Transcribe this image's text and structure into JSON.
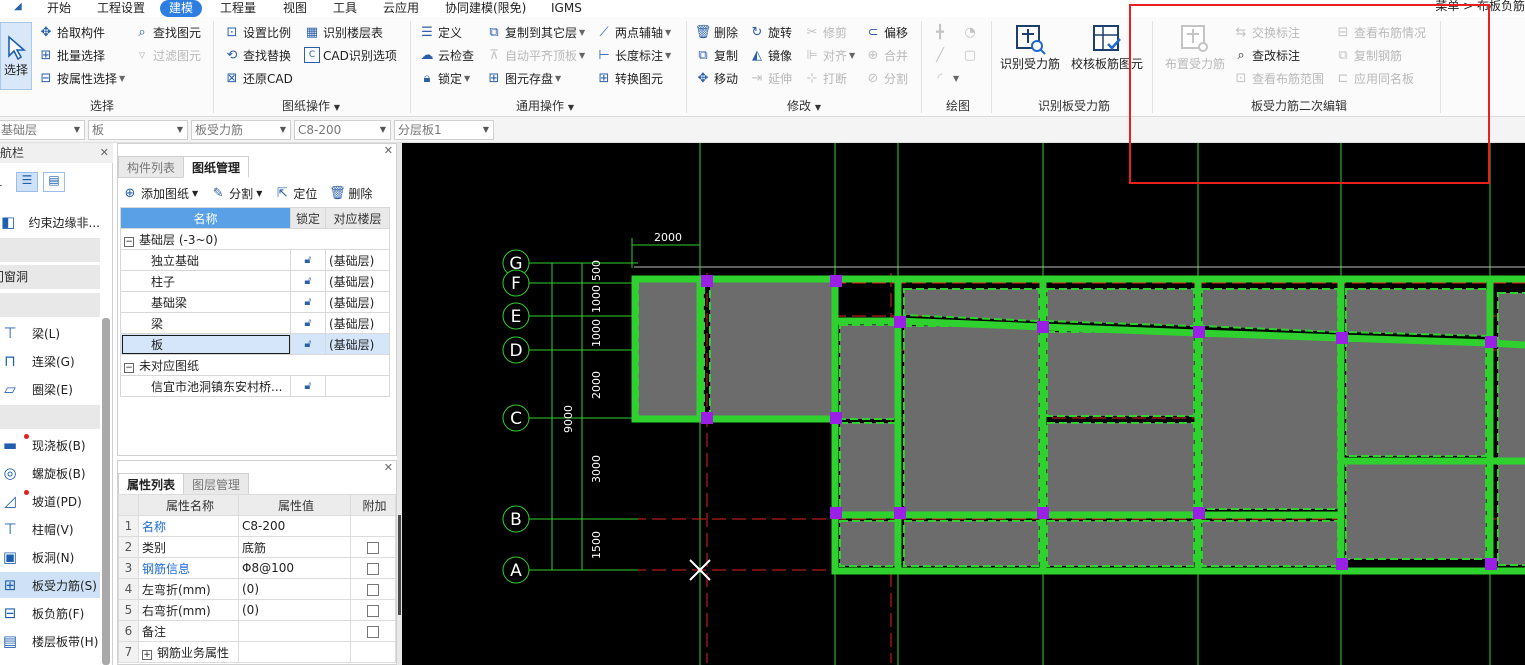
{
  "menu": {
    "items": [
      "开始",
      "工程设置",
      "建模",
      "工程量",
      "视图",
      "工具",
      "云应用",
      "协同建模(限免)",
      "IGMS"
    ],
    "active": "建模",
    "breadcrumb": "菜单 > 布板负筋"
  },
  "ribbon": {
    "select_group": {
      "label": "选择",
      "select_button": "选择",
      "pick_component": "拾取构件",
      "batch_select": "批量选择",
      "select_by_attr": "按属性选择",
      "find_element": "查找图元",
      "filter_element": "过滤图元"
    },
    "drawing_group": {
      "label": "图纸操作",
      "set_scale": "设置比例",
      "find_replace": "查找替换",
      "restore_cad": "还原CAD",
      "identify_floor_table": "识别楼层表",
      "cad_options": "CAD识别选项"
    },
    "general_group": {
      "label": "通用操作",
      "define": "定义",
      "cloud_check": "云检查",
      "lock": "锁定",
      "copy_to_other_floor": "复制到其它层",
      "auto_align_top": "自动平齐顶板",
      "element_save": "图元存盘",
      "two_point_axis": "两点辅轴",
      "length_label": "长度标注",
      "convert_element": "转换图元"
    },
    "modify_group": {
      "label": "修改",
      "delete": "删除",
      "copy": "复制",
      "move": "移动",
      "rotate": "旋转",
      "mirror": "镜像",
      "extend": "延伸",
      "trim": "修剪",
      "align": "对齐",
      "break": "打断",
      "offset": "偏移",
      "merge": "合并",
      "split": "分割"
    },
    "draw_group": {
      "label": "绘图"
    },
    "identify_group": {
      "label": "识别板受力筋",
      "identify_rebar": "识别受力筋",
      "check_rebar": "校核板筋图元"
    },
    "secondary_group": {
      "label": "板受力筋二次编辑",
      "place_rebar": "布置受力筋",
      "swap_label": "交换标注",
      "check_label": "查改标注",
      "view_range": "查看布筋范围",
      "view_status": "查看布筋情况",
      "copy_rebar": "复制钢筋",
      "apply_same_name": "应用同名板"
    }
  },
  "filterbar": {
    "floor": "基础层",
    "category": "板",
    "type": "板受力筋",
    "name": "C8-200",
    "layer": "分层板1"
  },
  "nav": {
    "title": "导航栏",
    "items": [
      {
        "label": "约束边缘非...",
        "icon": "constraint-icon"
      },
      {
        "category": "门窗洞"
      },
      {
        "label": "梁(L)",
        "icon": "beam-icon"
      },
      {
        "label": "连梁(G)",
        "icon": "coupling-beam-icon"
      },
      {
        "label": "圈梁(E)",
        "icon": "ring-beam-icon"
      },
      {
        "label": "现浇板(B)",
        "icon": "cast-slab-icon"
      },
      {
        "label": "螺旋板(B)",
        "icon": "spiral-slab-icon"
      },
      {
        "label": "坡道(PD)",
        "icon": "ramp-icon"
      },
      {
        "label": "柱帽(V)",
        "icon": "column-cap-icon"
      },
      {
        "label": "板洞(N)",
        "icon": "slab-hole-icon"
      },
      {
        "label": "板受力筋(S)",
        "icon": "slab-rebar-icon"
      },
      {
        "label": "板负筋(F)",
        "icon": "negative-rebar-icon"
      },
      {
        "label": "楼层板带(H)",
        "icon": "slab-strip-icon"
      }
    ]
  },
  "drawing_panel": {
    "tabs": [
      "构件列表",
      "图纸管理"
    ],
    "active_tab": "图纸管理",
    "toolbar": {
      "add": "添加图纸",
      "split": "分割",
      "locate": "定位",
      "delete": "删除"
    },
    "headers": {
      "name": "名称",
      "lock": "锁定",
      "floor": "对应楼层"
    },
    "groups": [
      {
        "label": "基础层 (-3~0)",
        "rows": [
          {
            "name": "独立基础",
            "floor": "(基础层)"
          },
          {
            "name": "柱子",
            "floor": "(基础层)"
          },
          {
            "name": "基础梁",
            "floor": "(基础层)"
          },
          {
            "name": "梁",
            "floor": "(基础层)"
          },
          {
            "name": "板",
            "floor": "(基础层)"
          }
        ]
      },
      {
        "label": "未对应图纸",
        "rows": [
          {
            "name": "信宜市池洞镇东安村桥...",
            "floor": ""
          }
        ]
      }
    ]
  },
  "property_panel": {
    "tabs": [
      "属性列表",
      "图层管理"
    ],
    "active_tab": "属性列表",
    "headers": {
      "name": "属性名称",
      "value": "属性值",
      "extra": "附加"
    },
    "rows": [
      {
        "idx": "1",
        "name": "名称",
        "value": "C8-200"
      },
      {
        "idx": "2",
        "name": "类别",
        "value": "底筋"
      },
      {
        "idx": "3",
        "name": "钢筋信息",
        "value": "Φ8@100"
      },
      {
        "idx": "4",
        "name": "左弯折(mm)",
        "value": "(0)"
      },
      {
        "idx": "5",
        "name": "右弯折(mm)",
        "value": "(0)"
      },
      {
        "idx": "6",
        "name": "备注",
        "value": ""
      },
      {
        "idx": "7",
        "name": "钢筋业务属性",
        "value": ""
      }
    ]
  },
  "cad": {
    "axes": [
      "G",
      "F",
      "E",
      "D",
      "C",
      "B",
      "A"
    ],
    "dimensions": [
      "2000",
      "500",
      "1000",
      "1000",
      "2000",
      "3000",
      "1500",
      "9000"
    ]
  },
  "colors": {
    "accent": "#2d7ee0",
    "highlight_box": "#e8201e",
    "cad_green": "#2fd12f",
    "cad_background": "#000000",
    "slab_fill": "#6c6c6c",
    "node": "#9b20e6"
  }
}
